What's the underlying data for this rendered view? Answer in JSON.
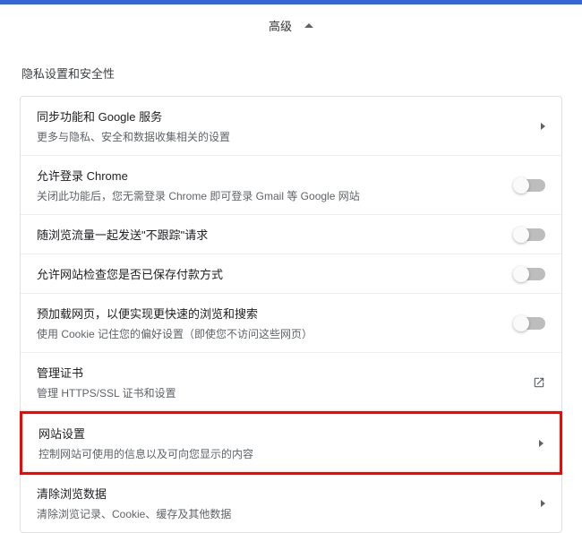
{
  "header": {
    "advanced_label": "高级"
  },
  "section": {
    "title": "隐私设置和安全性"
  },
  "settings": {
    "sync": {
      "title": "同步功能和 Google 服务",
      "subtitle": "更多与隐私、安全和数据收集相关的设置"
    },
    "allow_login": {
      "title": "允许登录 Chrome",
      "subtitle": "关闭此功能后，您无需登录 Chrome 即可登录 Gmail 等 Google 网站"
    },
    "do_not_track": {
      "title": "随浏览流量一起发送\"不跟踪\"请求"
    },
    "payment_check": {
      "title": "允许网站检查您是否已保存付款方式"
    },
    "preload": {
      "title": "预加载网页，以便实现更快速的浏览和搜索",
      "subtitle": "使用 Cookie 记住您的偏好设置（即使您不访问这些网页）"
    },
    "certificates": {
      "title": "管理证书",
      "subtitle": "管理 HTTPS/SSL 证书和设置"
    },
    "site_settings": {
      "title": "网站设置",
      "subtitle": "控制网站可使用的信息以及可向您显示的内容"
    },
    "clear_data": {
      "title": "清除浏览数据",
      "subtitle": "清除浏览记录、Cookie、缓存及其他数据"
    }
  }
}
